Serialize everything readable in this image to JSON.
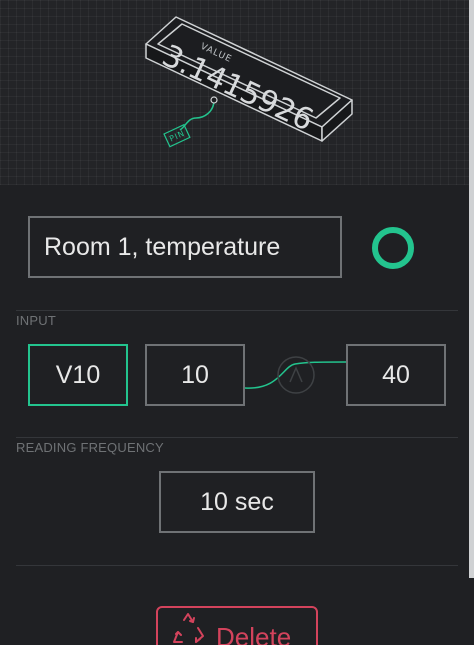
{
  "header": {
    "illustration_label": "VALUE",
    "illustration_value": "3.1415926",
    "pin_label": "PIN"
  },
  "widget": {
    "name_value": "Room 1, temperature",
    "color": "#23c48e"
  },
  "input": {
    "section_label": "INPUT",
    "pin": "V10",
    "min": "10",
    "max": "40"
  },
  "reading_frequency": {
    "section_label": "READING FREQUENCY",
    "value": "10 sec"
  },
  "delete_button": {
    "label": "Delete",
    "color": "#d3435c"
  }
}
